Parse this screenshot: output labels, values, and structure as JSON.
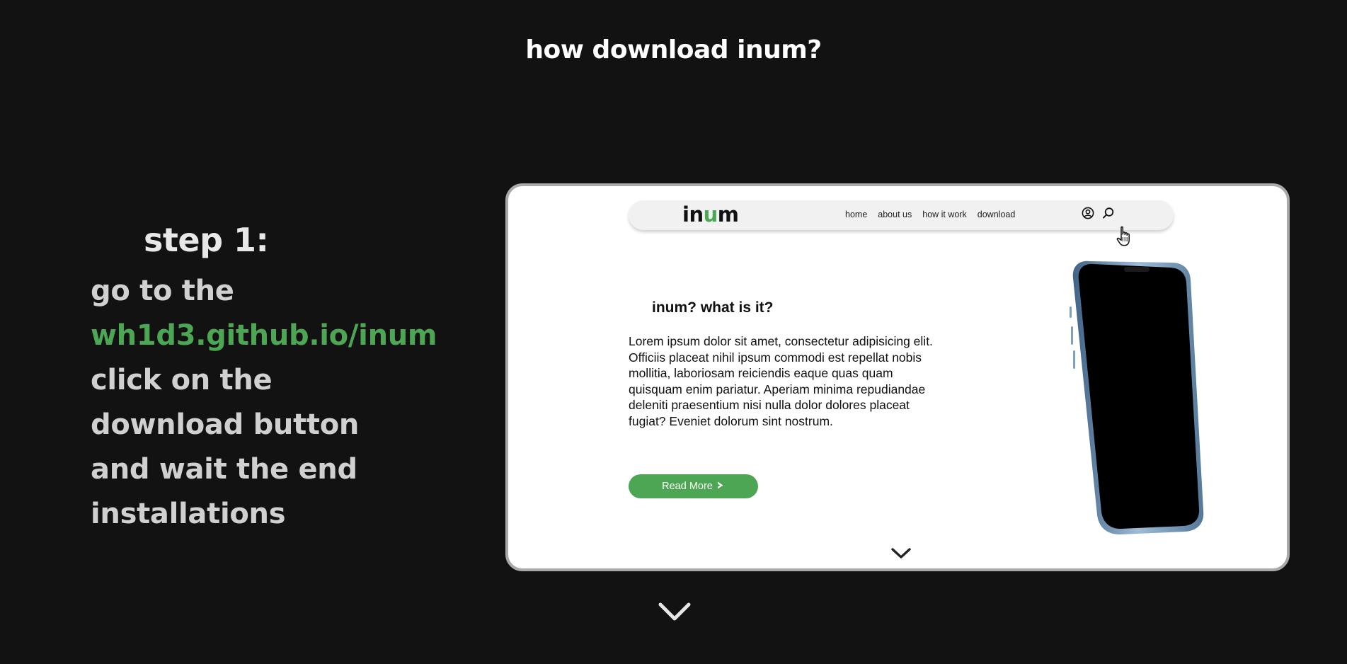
{
  "page": {
    "title": "how download inum?"
  },
  "step": {
    "heading": "step 1:",
    "lines": {
      "l1": "go to the",
      "link": "wh1d3.github.io/inum",
      "l3": "click on the",
      "l4": "download button",
      "l5": "and wait the end",
      "l6": "installations"
    }
  },
  "preview": {
    "logo": {
      "part1": "in",
      "accent": "u",
      "part2": "m"
    },
    "nav": {
      "home": "home",
      "about": "about us",
      "how": "how it work",
      "download": "download"
    },
    "icons": {
      "account": "user-circle-icon",
      "search": "search-icon",
      "cursor": "hand-pointer-icon"
    },
    "heading": "inum? what is it?",
    "body": "Lorem ipsum dolor sit amet, consectetur adipisicing elit. Officiis placeat nihil ipsum commodi est repellat nobis mollitia, laboriosam reiciendis eaque quas quam quisquam enim pariatur. Aperiam minima repudiandae deleniti praesentium nisi nulla dolor dolores placeat fugiat? Eveniet dolorum sint nostrum.",
    "button": "Read More"
  },
  "colors": {
    "background": "#121212",
    "accent": "#4ca653",
    "frame_border": "#a9a9a9"
  }
}
